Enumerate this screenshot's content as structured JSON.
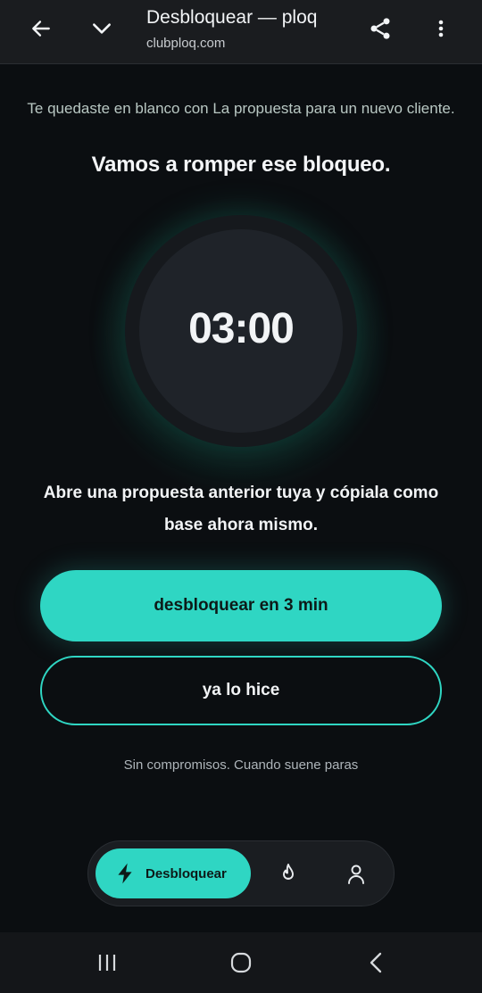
{
  "browser": {
    "title": "Desbloquear — ploq",
    "url": "clubploq.com"
  },
  "main": {
    "intro": "Te quedaste en blanco con La propuesta para un nuevo cliente.",
    "headline": "Vamos a romper ese bloqueo.",
    "timer": "03:00",
    "instruction": "Abre una propuesta anterior tuya y cópiala como base ahora mismo.",
    "primary_button": "desbloquear en 3 min",
    "secondary_button": "ya lo hice",
    "footnote": "Sin compromisos. Cuando suene paras"
  },
  "tabbar": {
    "active_label": "Desbloquear",
    "tabs": [
      {
        "icon": "bolt-icon",
        "label": "Desbloquear",
        "active": true
      },
      {
        "icon": "flame-icon",
        "active": false
      },
      {
        "icon": "user-icon",
        "active": false
      }
    ]
  },
  "colors": {
    "accent": "#2fd6c3",
    "background": "#0b0e11",
    "surface": "#1a1d21"
  }
}
